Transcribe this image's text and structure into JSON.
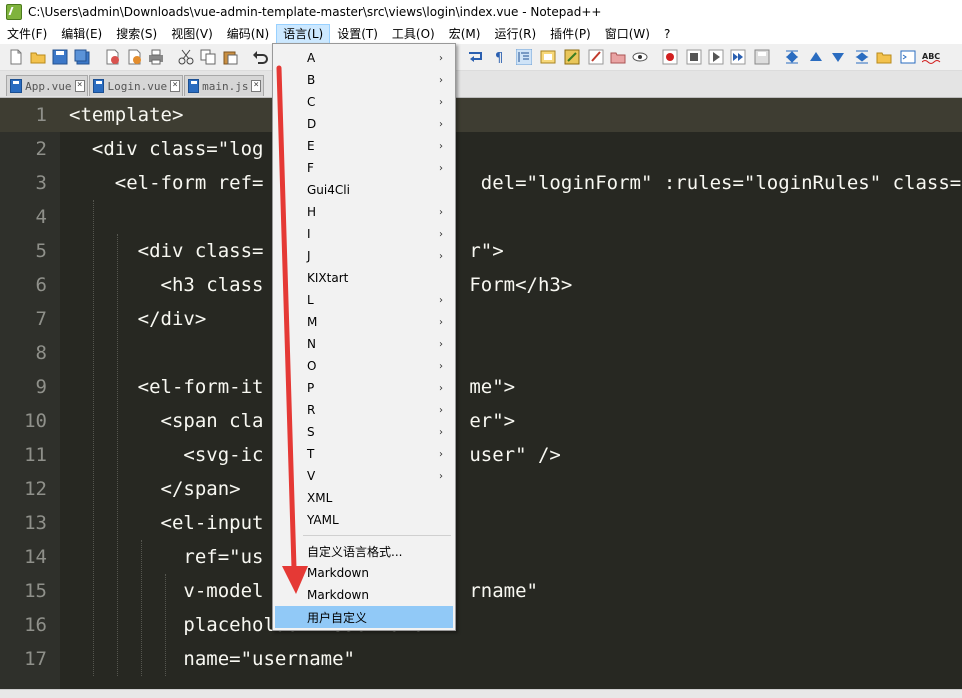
{
  "window": {
    "title": "C:\\Users\\admin\\Downloads\\vue-admin-template-master\\src\\views\\login\\index.vue - Notepad++"
  },
  "menubar": {
    "items": [
      "文件(F)",
      "编辑(E)",
      "搜索(S)",
      "视图(V)",
      "编码(N)",
      "语言(L)",
      "设置(T)",
      "工具(O)",
      "宏(M)",
      "运行(R)",
      "插件(P)",
      "窗口(W)",
      "?"
    ],
    "active_index": 5
  },
  "tabs": [
    {
      "label": "App.vue"
    },
    {
      "label": "Login.vue"
    },
    {
      "label": "main.js"
    }
  ],
  "language_menu": {
    "items": [
      {
        "label": "A",
        "submenu": true
      },
      {
        "label": "B",
        "submenu": true
      },
      {
        "label": "C",
        "submenu": true
      },
      {
        "label": "D",
        "submenu": true
      },
      {
        "label": "E",
        "submenu": true
      },
      {
        "label": "F",
        "submenu": true
      },
      {
        "label": "Gui4Cli",
        "submenu": false
      },
      {
        "label": "H",
        "submenu": true
      },
      {
        "label": "I",
        "submenu": true
      },
      {
        "label": "J",
        "submenu": true
      },
      {
        "label": "KIXtart",
        "submenu": false
      },
      {
        "label": "L",
        "submenu": true
      },
      {
        "label": "M",
        "submenu": true
      },
      {
        "label": "N",
        "submenu": true
      },
      {
        "label": "O",
        "submenu": true
      },
      {
        "label": "P",
        "submenu": true
      },
      {
        "label": "R",
        "submenu": true
      },
      {
        "label": "S",
        "submenu": true
      },
      {
        "label": "T",
        "submenu": true
      },
      {
        "label": "V",
        "submenu": true
      },
      {
        "label": "XML",
        "submenu": false
      },
      {
        "label": "YAML",
        "submenu": false
      }
    ],
    "custom_items": [
      {
        "label": "自定义语言格式..."
      },
      {
        "label": "Markdown"
      },
      {
        "label": "Markdown"
      },
      {
        "label": "用户自定义"
      }
    ],
    "submenu_arrow": "›",
    "highlighted": "用户自定义"
  },
  "editor": {
    "lines": [
      {
        "num": "1",
        "text": "<template>",
        "current": true
      },
      {
        "num": "2",
        "text": "  <div class=\"log"
      },
      {
        "num": "3",
        "text": "    <el-form ref=                   del=\"loginForm\" :rules=\"loginRules\" class=\""
      },
      {
        "num": "4",
        "text": ""
      },
      {
        "num": "5",
        "text": "      <div class=                  r\">"
      },
      {
        "num": "6",
        "text": "        <h3 class                  Form</h3>"
      },
      {
        "num": "7",
        "text": "      </div>"
      },
      {
        "num": "8",
        "text": ""
      },
      {
        "num": "9",
        "text": "      <el-form-it                  me\">"
      },
      {
        "num": "10",
        "text": "        <span cla                  er\">"
      },
      {
        "num": "11",
        "text": "          <svg-ic                  user\" />"
      },
      {
        "num": "12",
        "text": "        </span>"
      },
      {
        "num": "13",
        "text": "        <el-input"
      },
      {
        "num": "14",
        "text": "          ref=\"us"
      },
      {
        "num": "15",
        "text": "          v-model                  rname\""
      },
      {
        "num": "16",
        "text": "          placeholder=\"Username\""
      },
      {
        "num": "17",
        "text": "          name=\"username\""
      }
    ]
  },
  "colors": {
    "editor_bg": "#272822",
    "menu_highlight": "#91c9f7",
    "annotation_arrow": "#e53935"
  }
}
